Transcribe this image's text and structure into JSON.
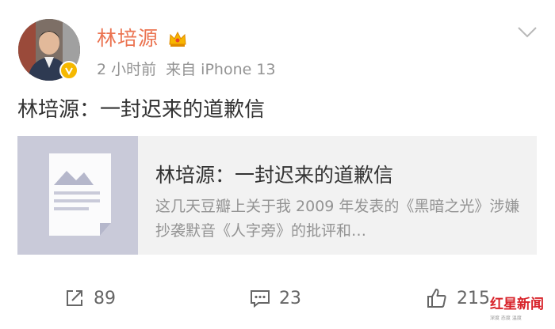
{
  "post": {
    "username": "林培源",
    "time": "2 小时前",
    "source": "来自 iPhone 13",
    "text": "林培源：一封迟来的道歉信"
  },
  "card": {
    "title": "林培源：一封迟来的道歉信",
    "description": "这几天豆瓣上关于我 2009 年发表的《黑暗之光》涉嫌抄袭默音《人字旁》的批评和…"
  },
  "actions": {
    "repost_count": "89",
    "comment_count": "23",
    "like_count": "215"
  },
  "watermark": {
    "brand": "红星新闻",
    "tagline": "深度 态度 温度"
  },
  "colors": {
    "username": "#eb7350",
    "meta": "#939393",
    "card_bg": "#f2f2f2",
    "thumb_bg": "#c9cad9",
    "verified_badge": "#f5b800",
    "watermark": "#d8232a"
  },
  "icons": [
    "crown-icon",
    "verified-icon",
    "chevron-down-icon",
    "repost-icon",
    "comment-icon",
    "like-icon",
    "article-thumbnail-icon"
  ]
}
